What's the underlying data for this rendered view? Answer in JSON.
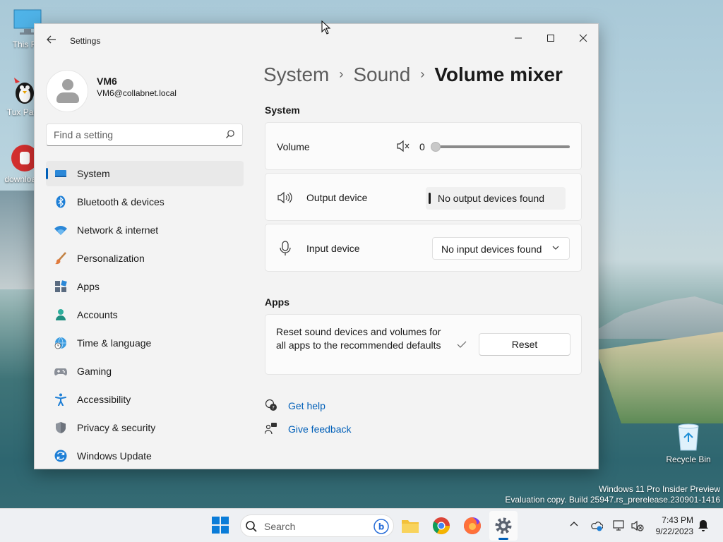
{
  "desktop": {
    "icons": [
      {
        "label": "This PC"
      },
      {
        "label": "Tux Paint"
      },
      {
        "label": "downloads"
      }
    ],
    "recycle_bin": "Recycle Bin",
    "watermark": {
      "line1": "Windows 11 Pro Insider Preview",
      "line2": "Evaluation copy. Build 25947.rs_prerelease.230901-1416"
    }
  },
  "window": {
    "title": "Settings",
    "controls": {
      "minimize": "—",
      "maximize": "☐",
      "close": "✕"
    }
  },
  "profile": {
    "name": "VM6",
    "email": "VM6@collabnet.local"
  },
  "search": {
    "placeholder": "Find a setting"
  },
  "sidebar": {
    "items": [
      {
        "label": "System",
        "icon": "system-icon",
        "active": true
      },
      {
        "label": "Bluetooth & devices",
        "icon": "bluetooth-icon"
      },
      {
        "label": "Network & internet",
        "icon": "wifi-icon"
      },
      {
        "label": "Personalization",
        "icon": "brush-icon"
      },
      {
        "label": "Apps",
        "icon": "apps-icon"
      },
      {
        "label": "Accounts",
        "icon": "accounts-icon"
      },
      {
        "label": "Time & language",
        "icon": "globe-clock-icon"
      },
      {
        "label": "Gaming",
        "icon": "gamepad-icon"
      },
      {
        "label": "Accessibility",
        "icon": "accessibility-icon"
      },
      {
        "label": "Privacy & security",
        "icon": "shield-icon"
      },
      {
        "label": "Windows Update",
        "icon": "update-icon"
      }
    ]
  },
  "breadcrumb": {
    "items": [
      "System",
      "Sound"
    ],
    "current": "Volume mixer",
    "separator": "›"
  },
  "system_section": {
    "title": "System",
    "volume_label": "Volume",
    "volume_value": "0",
    "output_label": "Output device",
    "output_value": "No output devices found",
    "input_label": "Input device",
    "input_value": "No input devices found"
  },
  "apps_section": {
    "title": "Apps",
    "reset_description": "Reset sound devices and volumes for all apps to the recommended defaults",
    "reset_button": "Reset"
  },
  "links": {
    "get_help": "Get help",
    "give_feedback": "Give feedback"
  },
  "taskbar": {
    "search_placeholder": "Search",
    "time": "7:43 PM",
    "date": "9/22/2023"
  },
  "colors": {
    "accent": "#005fb8",
    "window_bg": "#f3f3f3",
    "card_bg": "#fbfbfb"
  }
}
